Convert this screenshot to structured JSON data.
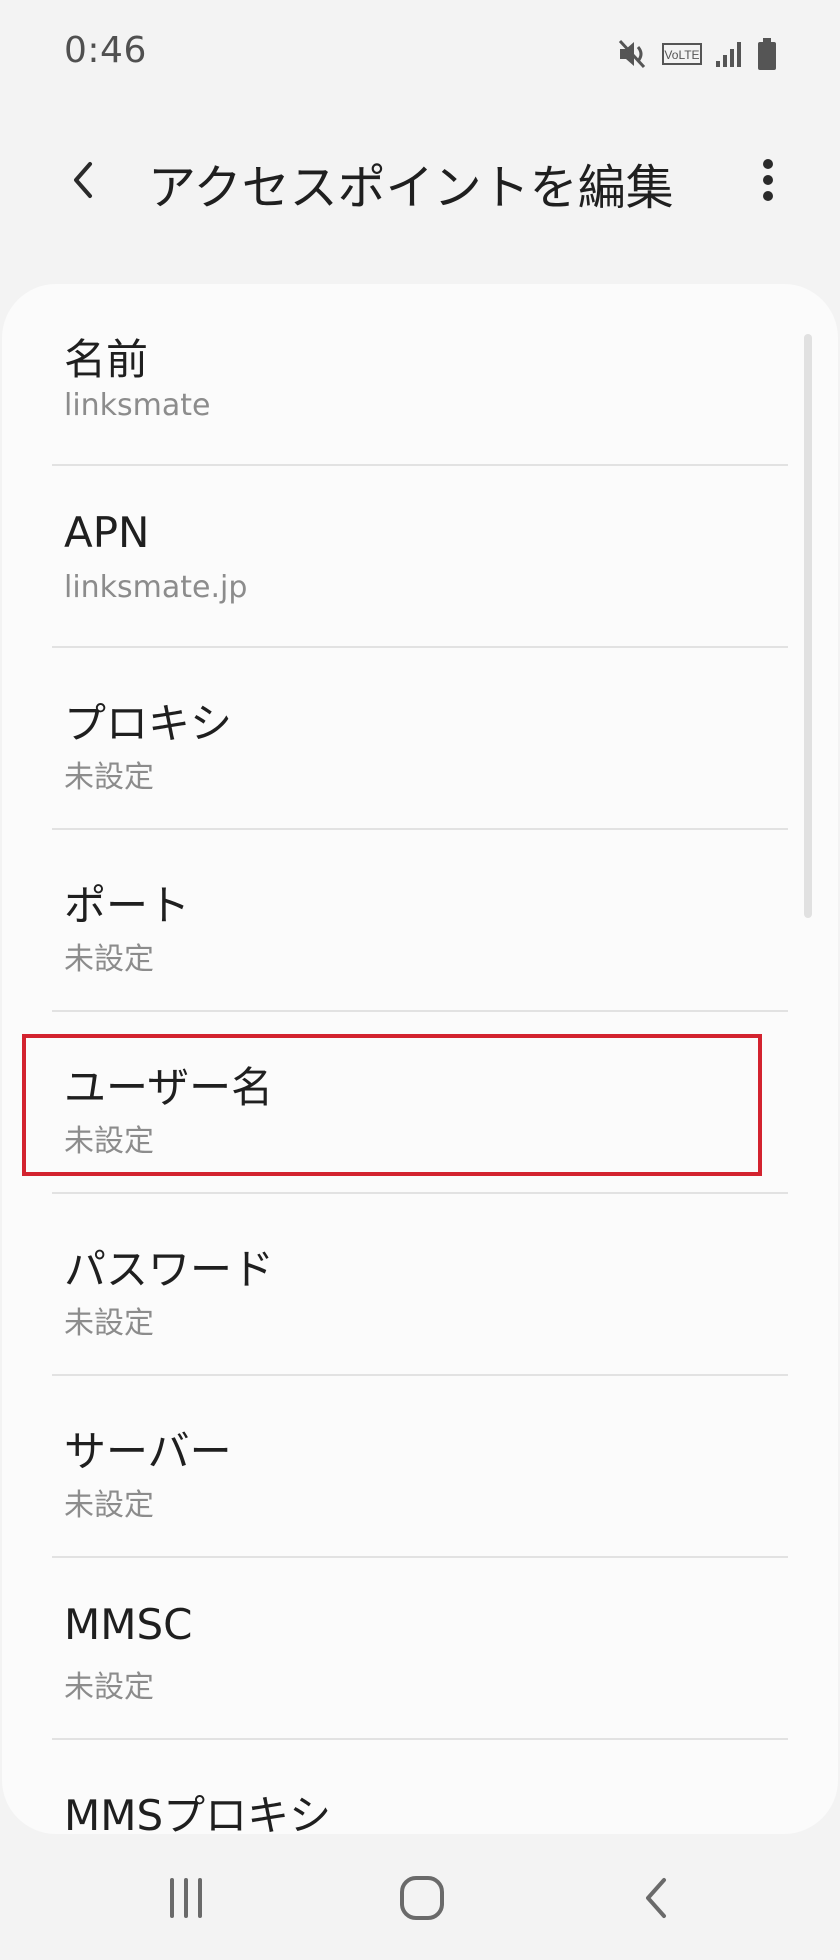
{
  "status_bar": {
    "time": "0:46",
    "icons": [
      "mute-icon",
      "volte-icon",
      "signal-icon",
      "battery-icon"
    ],
    "volte_label": "VoLTE"
  },
  "app_bar": {
    "title": "アクセスポイントを編集",
    "back_icon": "chevron-left-icon",
    "more_icon": "more-vertical-icon"
  },
  "settings": {
    "items": [
      {
        "title": "名前",
        "value": "linksmate"
      },
      {
        "title": "APN",
        "value": "linksmate.jp"
      },
      {
        "title": "プロキシ",
        "value": "未設定"
      },
      {
        "title": "ポート",
        "value": "未設定"
      },
      {
        "title": "ユーザー名",
        "value": "未設定"
      },
      {
        "title": "パスワード",
        "value": "未設定"
      },
      {
        "title": "サーバー",
        "value": "未設定"
      },
      {
        "title": "MMSC",
        "value": "未設定"
      },
      {
        "title": "MMSプロキシ",
        "value": ""
      }
    ],
    "highlighted_item": "ユーザー名"
  },
  "colors": {
    "background": "#f3f3f3",
    "card": "#fbfbfb",
    "highlight": "#d3232f",
    "secondary_text": "#8c8c8c"
  },
  "nav_bar": {
    "buttons": [
      "recents-icon",
      "home-icon",
      "back-icon"
    ]
  }
}
